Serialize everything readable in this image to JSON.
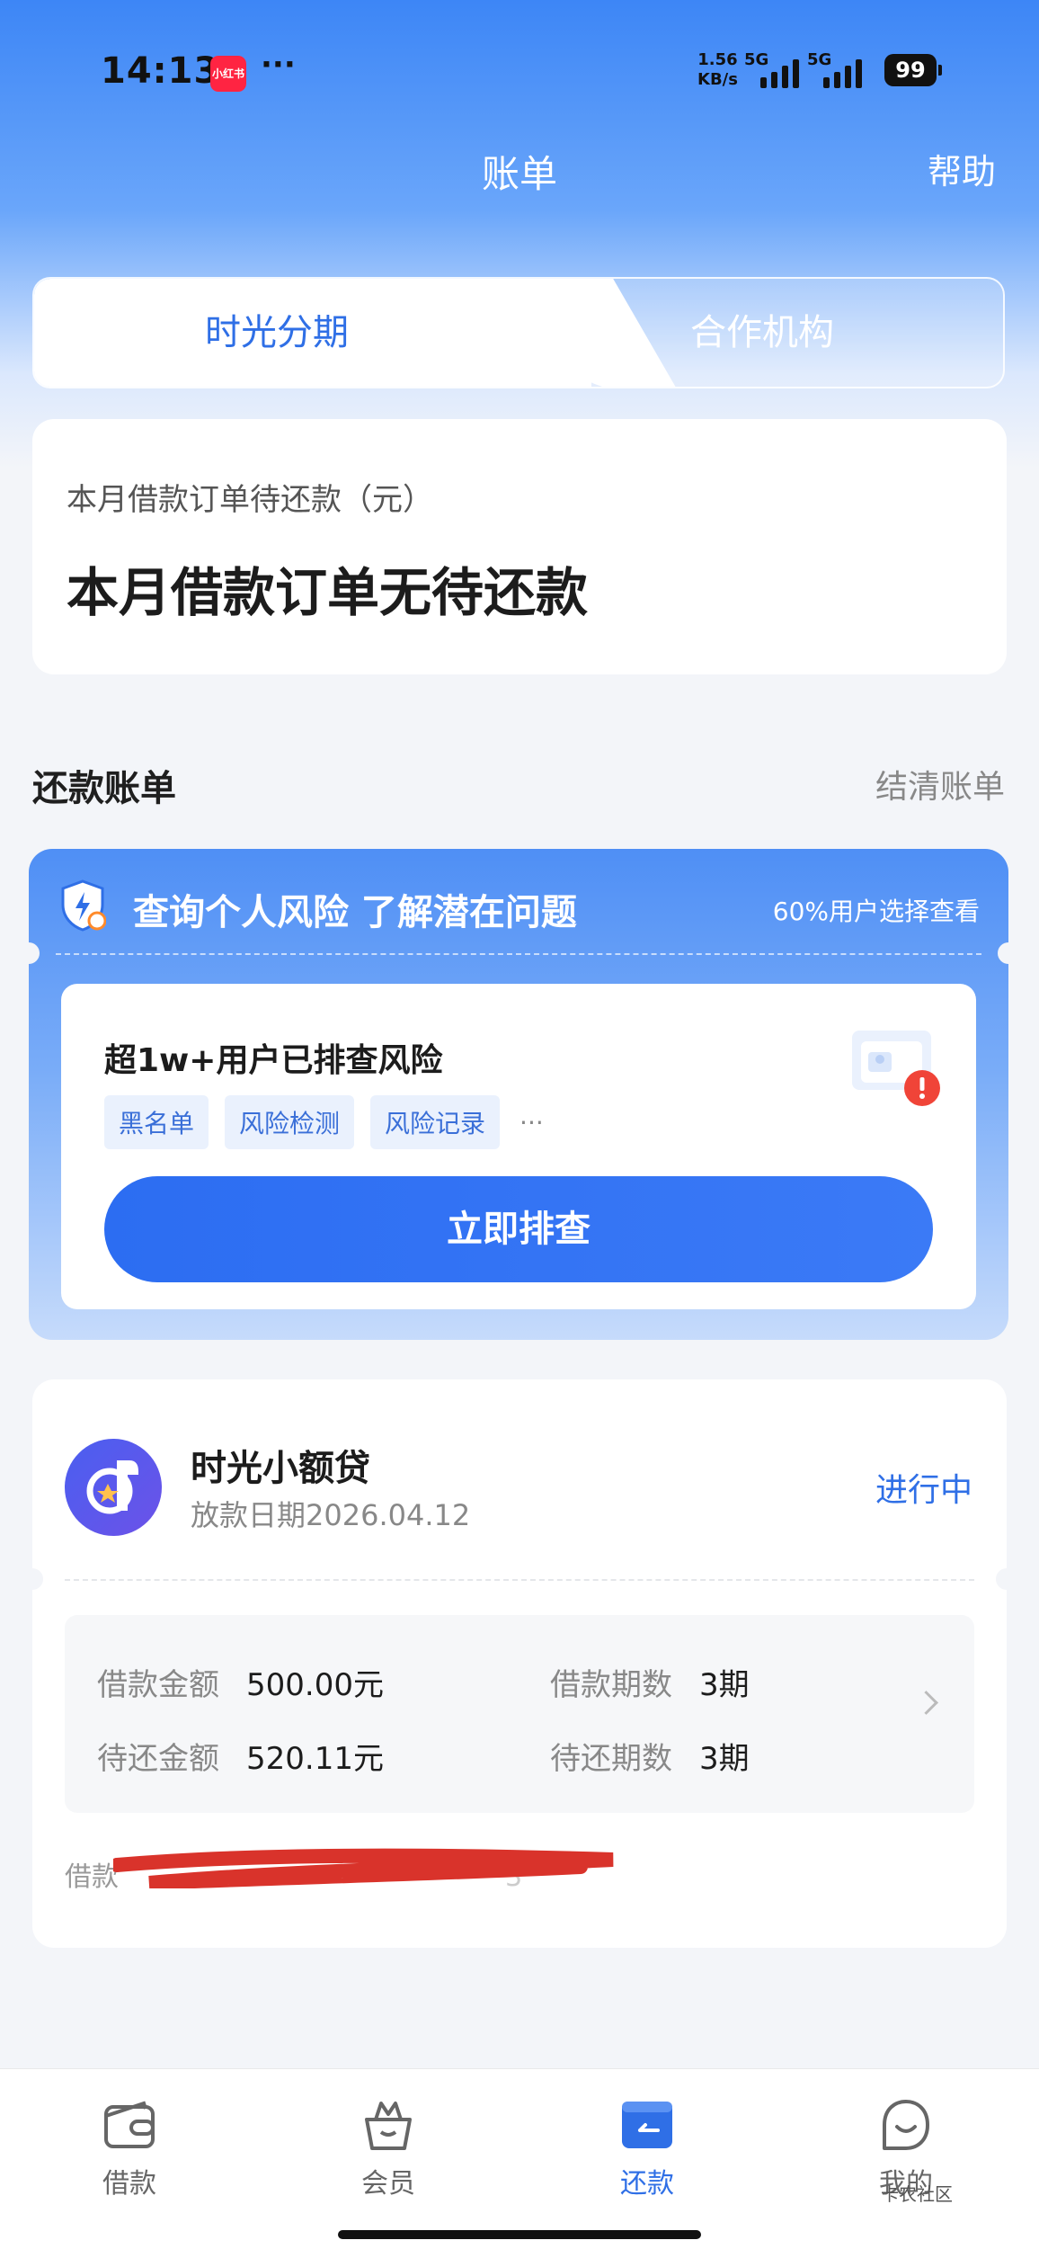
{
  "status_bar": {
    "time": "14:13",
    "app_badge": "小红书",
    "more": "···",
    "net_speed_value": "1.56",
    "net_speed_unit": "KB/s",
    "sim1": "5G",
    "sim2": "5G",
    "battery": "99"
  },
  "header": {
    "title": "账单",
    "help": "帮助"
  },
  "tabs": [
    {
      "label": "时光分期",
      "active": true
    },
    {
      "label": "合作机构",
      "active": false
    }
  ],
  "due_card": {
    "label": "本月借款订单待还款（元）",
    "value": "本月借款订单无待还款"
  },
  "bills_section": {
    "title": "还款账单",
    "link": "结清账单"
  },
  "risk_card": {
    "title": "查询个人风险 了解潜在问题",
    "note": "60%用户选择查看",
    "subtitle": "超1w+用户已排查风险",
    "tags": [
      "黑名单",
      "风险检测",
      "风险记录"
    ],
    "tags_more": "···",
    "cta": "立即排查"
  },
  "loan": {
    "name": "时光小额贷",
    "date": "放款日期2026.04.12",
    "status": "进行中",
    "amount_label": "借款金额",
    "amount_value": "500.00元",
    "periods_label": "借款期数",
    "periods_value": "3期",
    "due_label": "待还金额",
    "due_value": "520.11元",
    "due_periods_label": "待还期数",
    "due_periods_value": "3期",
    "loan_no_label": "借款",
    "loan_no_tail": "3"
  },
  "nav": [
    {
      "label": "借款",
      "icon": "wallet-icon"
    },
    {
      "label": "会员",
      "icon": "crown-bag-icon"
    },
    {
      "label": "还款",
      "icon": "repay-card-icon",
      "active": true
    },
    {
      "label": "我的",
      "icon": "smile-icon"
    }
  ],
  "watermark": "卡农社区",
  "colors": {
    "accent": "#2f6fe6",
    "header_gradient_top": "#3d86f6",
    "page_bg": "#f3f5f9"
  }
}
